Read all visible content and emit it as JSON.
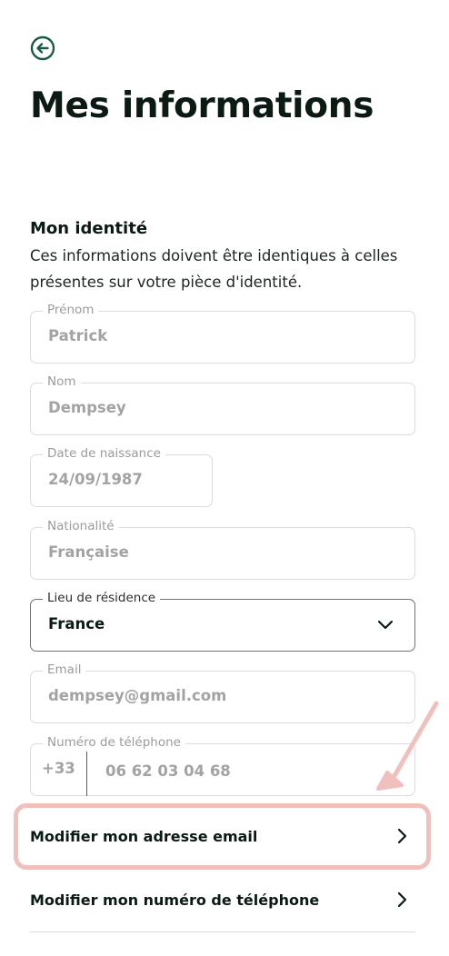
{
  "header": {
    "back_icon": "arrow-left-circle-icon",
    "title": "Mes informations"
  },
  "identity": {
    "title": "Mon identité",
    "description": "Ces informations doivent être identiques à celles présentes sur votre pièce d'identité."
  },
  "fields": {
    "first_name": {
      "label": "Prénom",
      "value": "Patrick"
    },
    "last_name": {
      "label": "Nom",
      "value": "Dempsey"
    },
    "birth_date": {
      "label": "Date de naissance",
      "value": "24/09/1987"
    },
    "nationality": {
      "label": "Nationalité",
      "value": "Française"
    },
    "residence": {
      "label": "Lieu de résidence",
      "value": "France"
    },
    "email": {
      "label": "Email",
      "value": "dempsey@gmail.com"
    },
    "phone": {
      "label": "Numéro de téléphone",
      "prefix": "+33",
      "value": "06 62 03 04 68"
    }
  },
  "actions": {
    "edit_email": "Modifier mon adresse email",
    "edit_phone": "Modifier mon numéro de téléphone"
  },
  "colors": {
    "accent": "#1e5a4a",
    "highlight": "#f0c0bd",
    "text": "#0b1a12",
    "muted": "#a3a3a3"
  }
}
